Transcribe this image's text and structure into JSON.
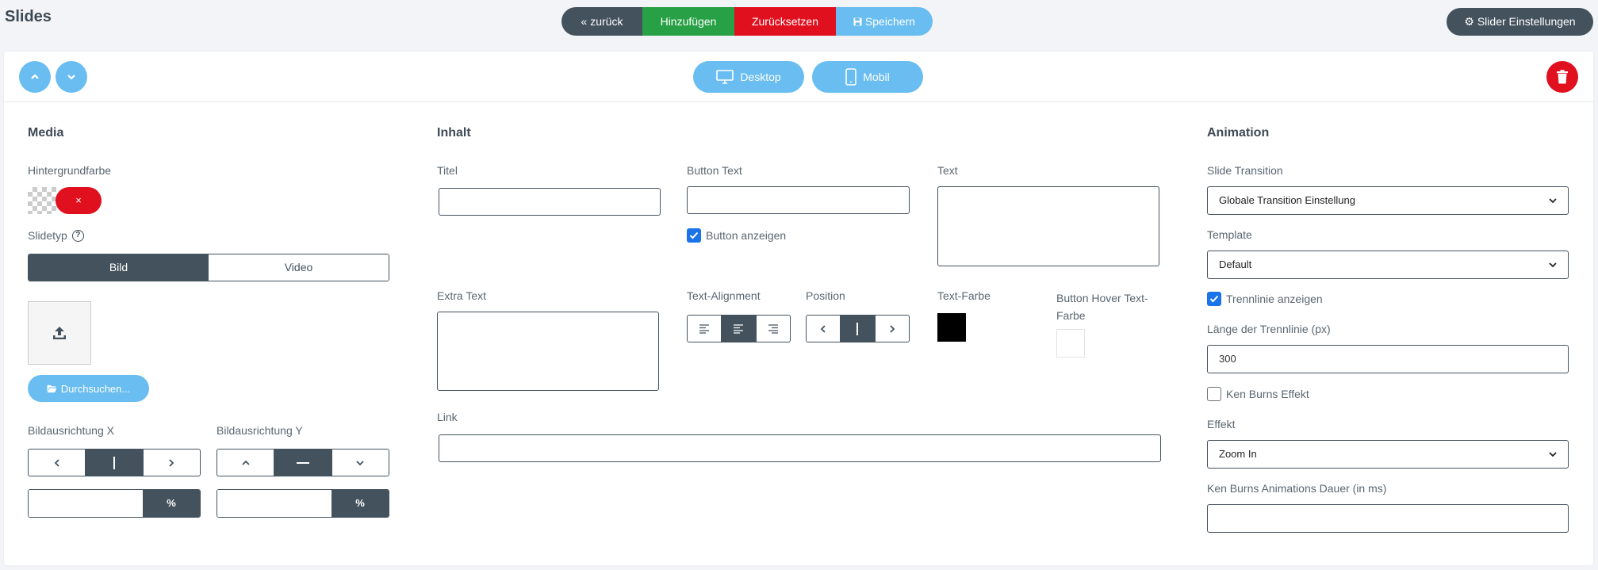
{
  "header": {
    "title": "Slides",
    "buttons": {
      "back": "zurück",
      "add": "Hinzufügen",
      "reset": "Zurücksetzen",
      "save": "Speichern"
    },
    "slider_settings": "Slider Einstellungen"
  },
  "toolbar": {
    "desktop": "Desktop",
    "mobile": "Mobil"
  },
  "media": {
    "section_title": "Media",
    "bg_color_label": "Hintergrundfarbe",
    "clear_symbol": "×",
    "slidetype_label": "Slidetyp",
    "help_symbol": "?",
    "slidetype_options": [
      "Bild",
      "Video"
    ],
    "slidetype_selected": "Bild",
    "browse_button": "Durchsuchen...",
    "align_x_label": "Bildausrichtung X",
    "align_y_label": "Bildausrichtung Y",
    "percent_unit": "%",
    "align_x_percent": "",
    "align_y_percent": ""
  },
  "content": {
    "section_title": "Inhalt",
    "title_label": "Titel",
    "title_value": "",
    "button_text_label": "Button Text",
    "button_text_value": "",
    "show_button_label": "Button anzeigen",
    "show_button_checked": true,
    "text_label": "Text",
    "extra_text_label": "Extra Text",
    "text_alignment_label": "Text-Alignment",
    "position_label": "Position",
    "text_color_label": "Text-Farbe",
    "text_color": "#000000",
    "button_hover_label": "Button Hover Text-Farbe",
    "button_hover_color": "#ffffff",
    "link_label": "Link",
    "link_value": ""
  },
  "animation": {
    "section_title": "Animation",
    "slide_transition_label": "Slide Transition",
    "slide_transition_value": "Globale Transition Einstellung",
    "template_label": "Template",
    "template_value": "Default",
    "divider_label": "Trennlinie anzeigen",
    "divider_checked": true,
    "divider_length_label": "Länge der Trennlinie (px)",
    "divider_length_value": "300",
    "ken_burns_label": "Ken Burns Effekt",
    "ken_burns_checked": false,
    "effect_label": "Effekt",
    "effect_value": "Zoom In",
    "ken_burns_duration_label": "Ken Burns Animations Dauer (in ms)",
    "ken_burns_duration_value": ""
  },
  "colors": {
    "dark": "#44525e",
    "green": "#28a046",
    "red": "#e0101f",
    "light_blue": "#69bdf0",
    "check_blue": "#1a73e8"
  }
}
